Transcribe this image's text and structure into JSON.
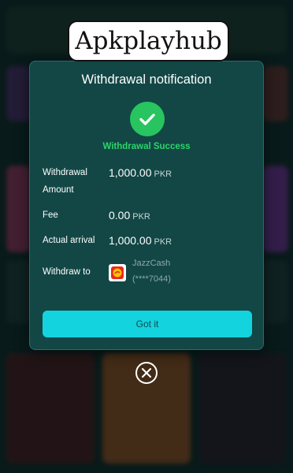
{
  "watermark": {
    "text": "Apkplayhub"
  },
  "dialog": {
    "title": "Withdrawal notification",
    "status_icon": "check-circle-icon",
    "status_text": "Withdrawal Success",
    "rows": [
      {
        "label_line1": "Withdrawal",
        "label_line2": "Amount",
        "value": "1,000.00",
        "currency": "PKR"
      },
      {
        "label": "Fee",
        "value": "0.00",
        "currency": "PKR"
      },
      {
        "label": "Actual arrival",
        "value": "1,000.00",
        "currency": "PKR"
      },
      {
        "label": "Withdraw to",
        "wallet_name": "JazzCash",
        "wallet_account": "(****7044)",
        "wallet_icon": "jazzcash-logo-icon"
      }
    ],
    "button_label": "Got it"
  },
  "close_icon": "close-circle-icon",
  "colors": {
    "dialog_bg": "#124746",
    "success": "#27c45f",
    "button": "#13d3df",
    "background": "#0d2424"
  }
}
